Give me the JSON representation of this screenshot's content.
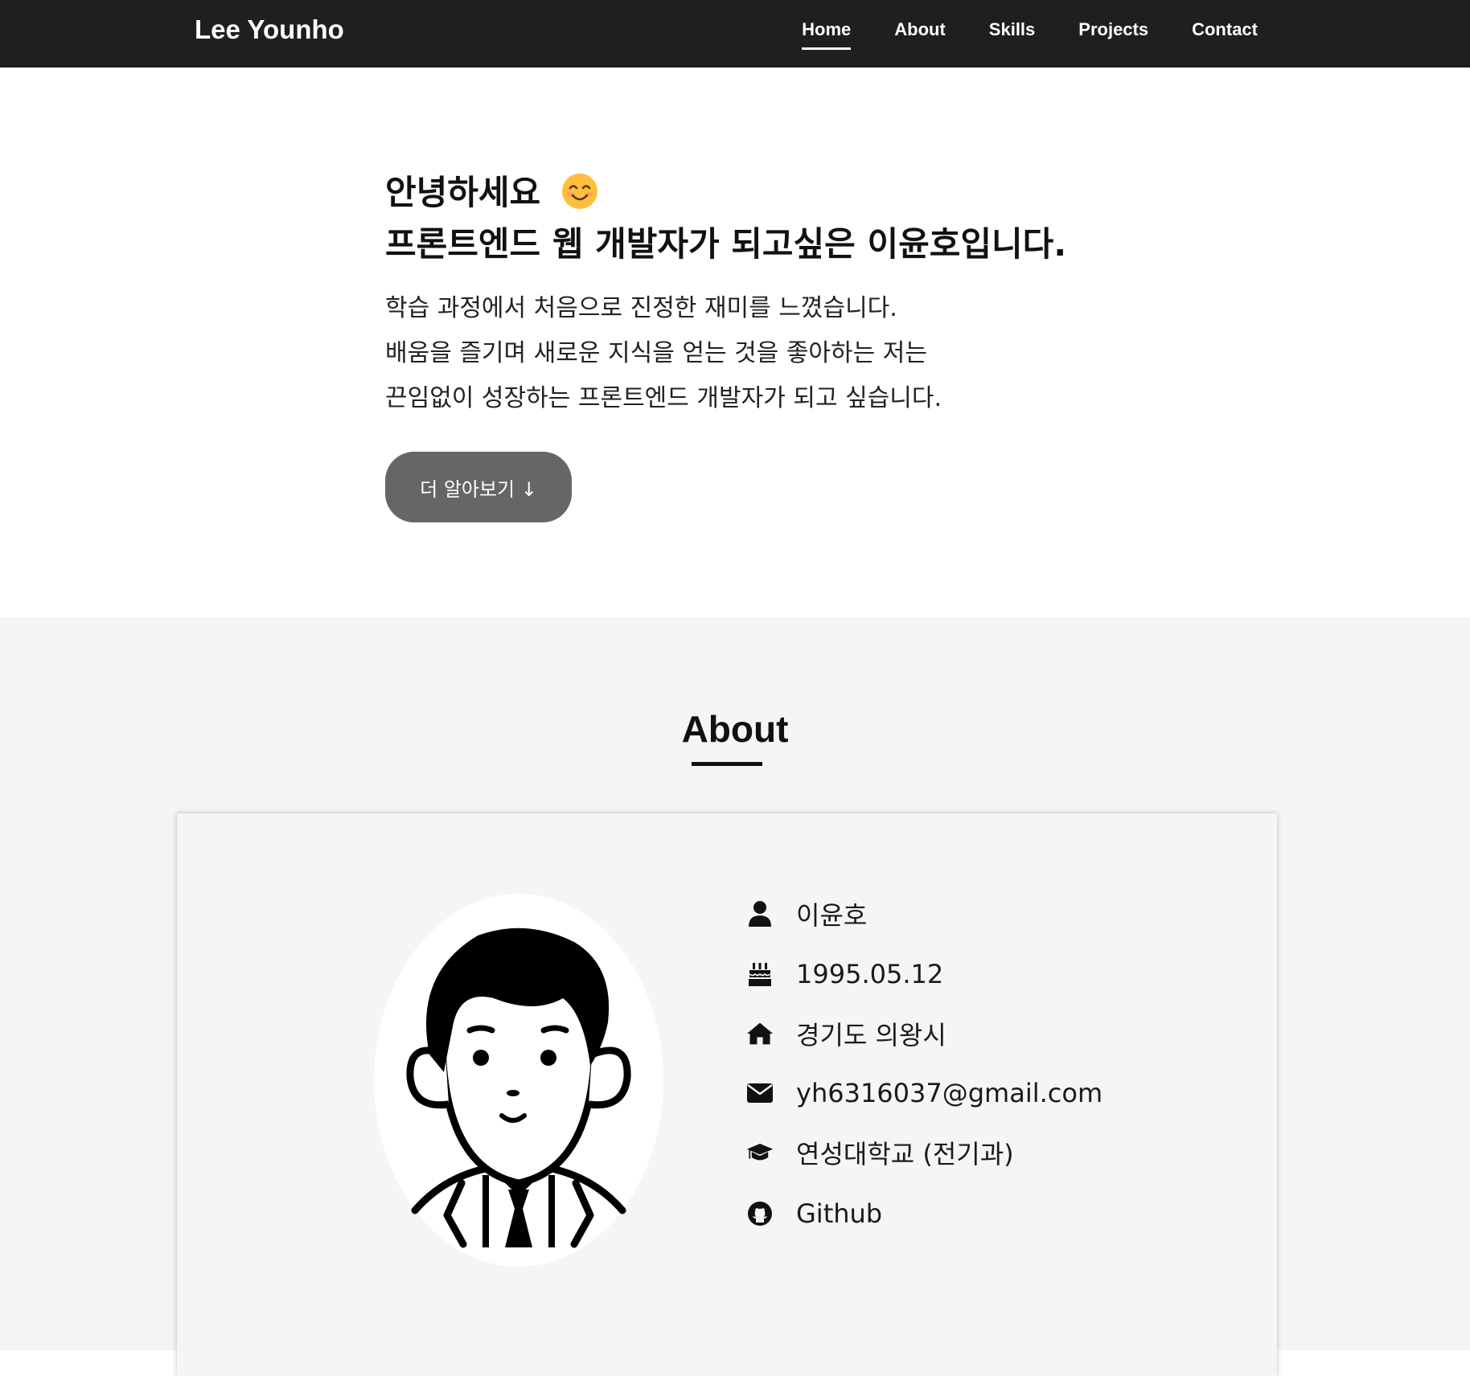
{
  "nav": {
    "brand": "Lee Younho",
    "links": [
      "Home",
      "About",
      "Skills",
      "Projects",
      "Contact"
    ],
    "active": "Home"
  },
  "hero": {
    "greeting": "안녕하세요",
    "greeting_icon": "smiling-face-icon",
    "headline": "프론트엔드 웹 개발자가 되고싶은 이윤호입니다.",
    "description": [
      "학습 과정에서 처음으로 진정한 재미를 느꼈습니다.",
      "배움을 즐기며 새로운 지식을 얻는 것을 좋아하는 저는",
      "끈임없이 성장하는 프론트엔드 개발자가 되고 싶습니다."
    ],
    "button_label": "더 알아보기 ↓"
  },
  "about": {
    "title": "About",
    "info": [
      {
        "icon": "user-icon",
        "text": "이윤호"
      },
      {
        "icon": "birthday-cake-icon",
        "text": "1995.05.12"
      },
      {
        "icon": "home-icon",
        "text": "경기도 의왕시"
      },
      {
        "icon": "envelope-icon",
        "text": "yh6316037@gmail.com"
      },
      {
        "icon": "graduation-cap-icon",
        "text": "연성대학교 (전기과)"
      },
      {
        "icon": "github-icon",
        "text": "Github"
      }
    ]
  },
  "colors": {
    "navbar_bg": "#1f1f1f",
    "button_bg": "#666666",
    "about_bg": "#f5f5f5",
    "emoji": "#ffbe3c"
  }
}
